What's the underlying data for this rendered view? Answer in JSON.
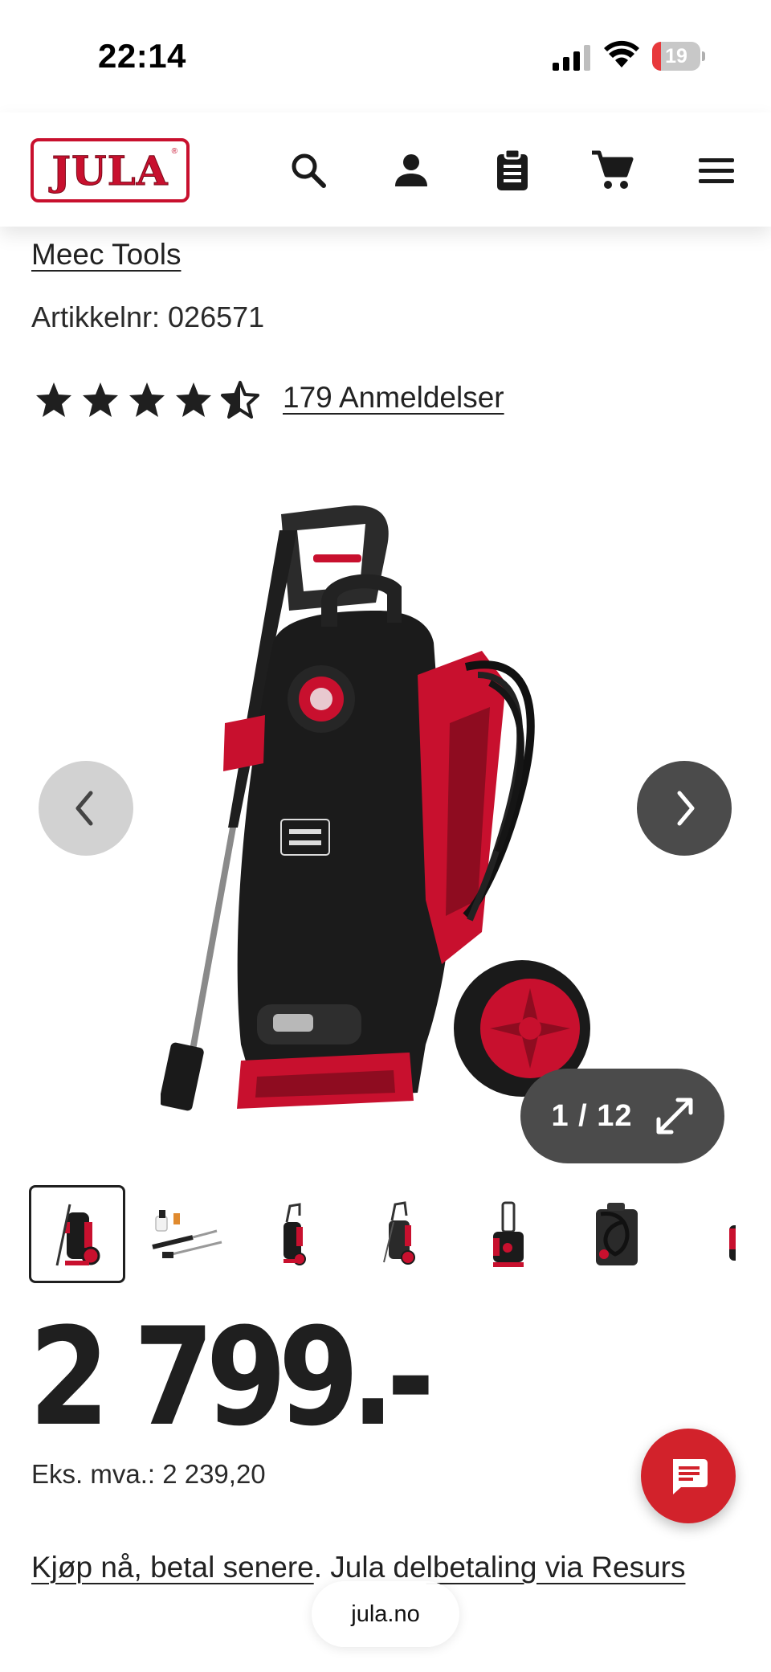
{
  "status_bar": {
    "time": "22:14",
    "battery_level": "19",
    "battery_fraction": 0.19,
    "battery_color": "#e8393c",
    "icons": [
      "cellular-signal-icon",
      "wifi-icon",
      "battery-icon"
    ]
  },
  "header": {
    "logo_text": "JULA",
    "brand_color": "#c8102e",
    "icons": [
      "search-icon",
      "account-icon",
      "clipboard-icon",
      "cart-icon",
      "menu-icon"
    ]
  },
  "product": {
    "brand": "Meec Tools",
    "sku_label": "Artikkelnr:",
    "sku_value": "026571",
    "rating": 4.5,
    "rating_max": 5,
    "reviews_label": "179 Anmeldelser",
    "price": "2 799.-",
    "price_ex_vat": "Eks. mva.: 2 239,20"
  },
  "gallery": {
    "image_name": "pressure-washer-image",
    "counter": "1 / 12",
    "current_index": 1,
    "total_images": 12,
    "prev_icon": "chevron-left-icon",
    "next_icon": "chevron-right-icon",
    "expand_icon": "expand-icon",
    "thumbnails": [
      {
        "name": "thumbnail-1",
        "active": true
      },
      {
        "name": "thumbnail-2",
        "active": false
      },
      {
        "name": "thumbnail-3",
        "active": false
      },
      {
        "name": "thumbnail-4",
        "active": false
      },
      {
        "name": "thumbnail-5",
        "active": false
      },
      {
        "name": "thumbnail-6",
        "active": false
      },
      {
        "name": "thumbnail-7",
        "active": false
      }
    ]
  },
  "financing": {
    "link_part1": "Kjøp nå, betal senere",
    "text_part2": ". Jula de",
    "link_part3": "lbetaling via Resurs"
  },
  "chat": {
    "icon": "chat-icon",
    "color": "#d2222b"
  },
  "browser": {
    "url": "jula.no"
  }
}
